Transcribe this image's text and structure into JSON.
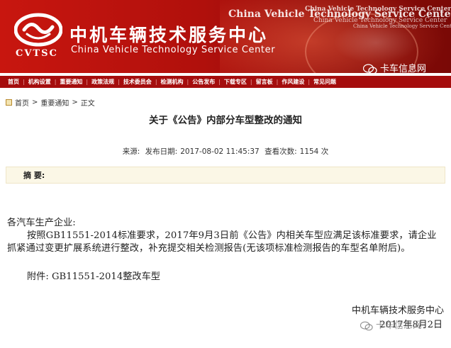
{
  "banner": {
    "logo_text": "CVTSC",
    "title_cn": "中机车辆技术服务中心",
    "title_en": "China Vehicle Technology Service Center",
    "ghost_text_1": "China Vehicle Technology Service Center",
    "ghost_text_2": "China Vehicle Technology Service Center",
    "ghost_text_3": "China Vehicle Technology Service Center",
    "ghost_text_4": "China Vehicle Technology Service Center",
    "watermark": "卡车信息网"
  },
  "nav": {
    "items": [
      "首页",
      "机构设置",
      "重要通知",
      "政策法规",
      "技术委员会",
      "检测机构",
      "公告发布",
      "下载专区",
      "留言板",
      "作风建设",
      "常见问题"
    ]
  },
  "breadcrumb": {
    "home": "首页",
    "sep1": ">",
    "section": "重要通知",
    "sep2": ">",
    "current": "正文"
  },
  "article": {
    "title": "关于《公告》内部分车型整改的通知",
    "source_label": "来源:",
    "date_label": "发布日期:",
    "date_value": "2017-08-02 11:45:37",
    "views_label": "查看次数:",
    "views_value": "1154 次",
    "summary_label": "摘 要:",
    "greeting": "各汽车生产企业:",
    "paragraph": "按照GB11551-2014标准要求，2017年9月3日前《公告》内相关车型应满足该标准要求，请企业抓紧通过变更扩展系统进行整改，补充提交相关检测报告(无该项标准检测报告的车型名单附后)。",
    "attachment": "附件: GB11551-2014整改车型",
    "sign_org": "中机车辆技术服务中心",
    "sign_date": "2017年8月2日",
    "watermark": "卡车信息网"
  },
  "colors": {
    "banner_red": "#b0100c",
    "nav_red": "#a50d0d",
    "summary_bg": "#fbf7e6"
  }
}
